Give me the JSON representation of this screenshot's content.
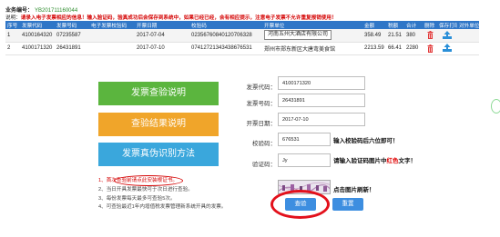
{
  "header": {
    "business_label": "业务编号：",
    "business_value": "YB201711160044",
    "notice_prefix": "说明：",
    "notice_red": "请录入电子发票相应的信息！输入验证码，验真成功后会保存到系统中，如果已经已经，会有相应提示，注意电子发票不允许重复报销使用！"
  },
  "table": {
    "columns": [
      "序号",
      "发票代码",
      "发票号码",
      "电子发票校验码",
      "开票日期",
      "校验码",
      "开票单位",
      "金额",
      "税额",
      "合计",
      "删除",
      "保存打印",
      "对外单位"
    ],
    "rows": [
      {
        "index": "1",
        "code": "4100164320",
        "number": "07235587",
        "check": "",
        "date": "2017-07-04",
        "verify": "02356760840120706328",
        "issuer": "河南五州大酒店有限公司",
        "amount": "358.49",
        "tax": "21.51",
        "total": "380"
      },
      {
        "index": "2",
        "code": "4100171320",
        "number": "26431891",
        "check": "",
        "date": "2017-07-10",
        "verify": "07412721343438676531",
        "issuer": "郑州市郑东新区大唐弯美食馆",
        "amount": "2213.59",
        "tax": "66.41",
        "total": "2280"
      }
    ]
  },
  "sidebar": {
    "btn_query_help": "发票查验说明",
    "btn_result_help": "查验结果说明",
    "btn_fake_help": "发票真伪识别方法"
  },
  "tips": [
    "1、首次查验前请点此安装根证书。",
    "2、当日开具发票最快可于次日进行查验。",
    "3、每份发票每天最多可查验5次。",
    "4、可查验最近1年内增值税发票管理新系统开具的发票。"
  ],
  "form": {
    "code_label": "发票代码：",
    "code_value": "4100171320",
    "number_label": "发票号码：",
    "number_value": "26431891",
    "date_label": "开票日期：",
    "date_value": "2017-07-10",
    "check_label": "校验码：",
    "check_value": "676531",
    "check_hint": "输入校验码后六位即可！",
    "captcha_label": "验证码：",
    "captcha_value": "Jy",
    "captcha_hint_prefix": "请输入验证码图片中",
    "captcha_hint_red": "红色",
    "captcha_hint_suffix": "文字！",
    "refresh_hint": "点击图片刷新！",
    "query_btn": "查验",
    "reset_btn": "重置"
  },
  "colors": {
    "header_blue": "#2f76c7",
    "green": "#5bb53e",
    "orange": "#f0a52a",
    "light_blue": "#3aa7dc",
    "red": "#d40000",
    "button_blue": "#3d8ee0"
  }
}
